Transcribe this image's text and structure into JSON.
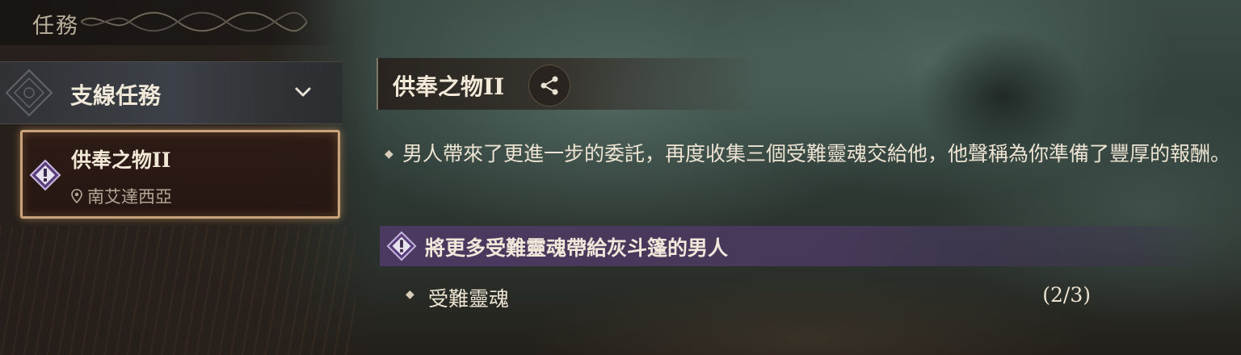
{
  "header": {
    "title": "任務"
  },
  "sidebar": {
    "category": {
      "label": "支線任務",
      "expanded": true
    },
    "quests": [
      {
        "title": "供奉之物II",
        "location": "南艾達西亞",
        "selected": true,
        "icon": "quest-marker-icon"
      }
    ]
  },
  "detail": {
    "title": "供奉之物II",
    "share_icon": "share-icon",
    "description": "男人帶來了更進一步的委託，再度收集三個受難靈魂交給他，他聲稱為你準備了豐厚的報酬。",
    "objective": {
      "label": "將更多受難靈魂帶給灰斗篷的男人",
      "icon": "quest-marker-icon",
      "color": "#4e3a64"
    },
    "sub_objectives": [
      {
        "label": "受難靈魂",
        "progress": "(2/3)"
      }
    ]
  },
  "colors": {
    "accent_gold": "#c9a47a",
    "objective_purple": "#4e3a64"
  }
}
